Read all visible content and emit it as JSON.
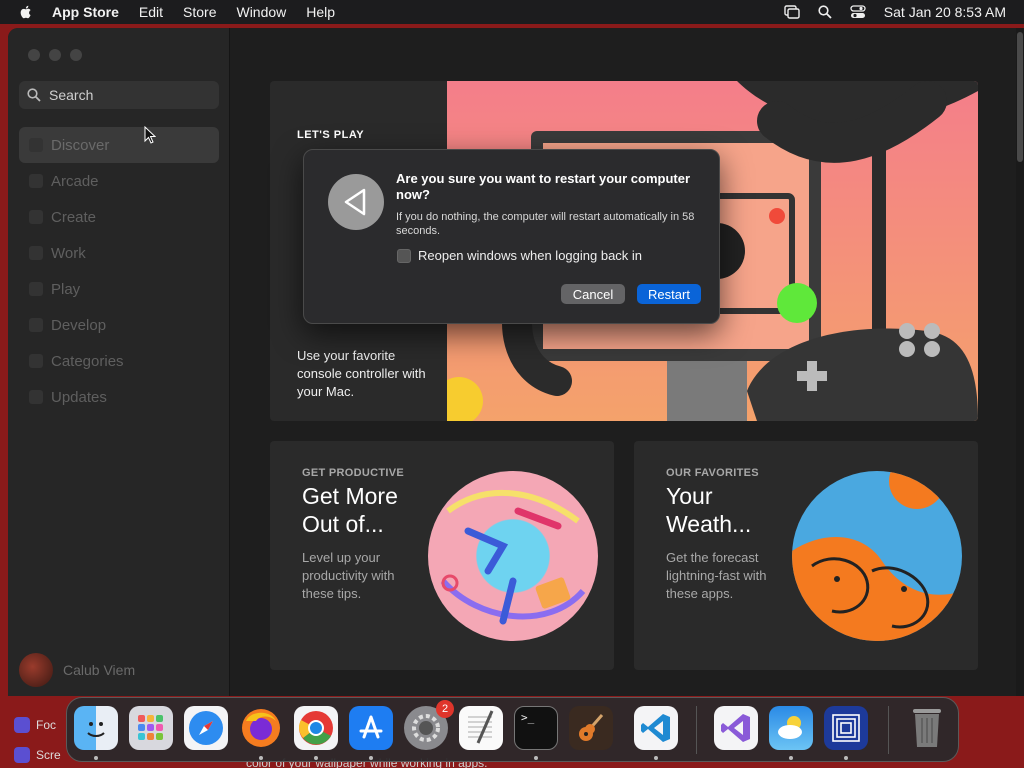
{
  "menubar": {
    "app_name": "App Store",
    "menus": [
      "Edit",
      "Store",
      "Window",
      "Help"
    ],
    "datetime": "Sat Jan 20  8:53 AM"
  },
  "sidebar": {
    "search_placeholder": "Search",
    "items": [
      {
        "label": "Discover"
      },
      {
        "label": "Arcade"
      },
      {
        "label": "Create"
      },
      {
        "label": "Work"
      },
      {
        "label": "Play"
      },
      {
        "label": "Develop"
      },
      {
        "label": "Categories"
      },
      {
        "label": "Updates"
      }
    ],
    "user_name": "Calub Viem"
  },
  "hero": {
    "eyebrow": "LET'S PLAY",
    "description": "Use your favorite console controller with your Mac."
  },
  "cards": [
    {
      "eyebrow": "GET PRODUCTIVE",
      "title": "Get More Out of...",
      "description": "Level up your productivity with these tips."
    },
    {
      "eyebrow": "OUR FAVORITES",
      "title": "Your Weath...",
      "description": "Get the forecast lightning-fast with these apps."
    }
  ],
  "dialog": {
    "title": "Are you sure you want to restart your computer now?",
    "message": "If you do nothing, the computer will restart automatically in 58 seconds.",
    "checkbox_label": "Reopen windows when logging back in",
    "cancel_label": "Cancel",
    "restart_label": "Restart"
  },
  "desktop": {
    "focus_label": "Foc",
    "screen_label": "Scre",
    "peek_text": "color of your wallpaper while working in apps."
  },
  "dock": {
    "settings_badge": "2",
    "terminal_prompt": ">_"
  },
  "colors": {
    "accent": "#0a64d8",
    "badge": "#e0352b"
  }
}
